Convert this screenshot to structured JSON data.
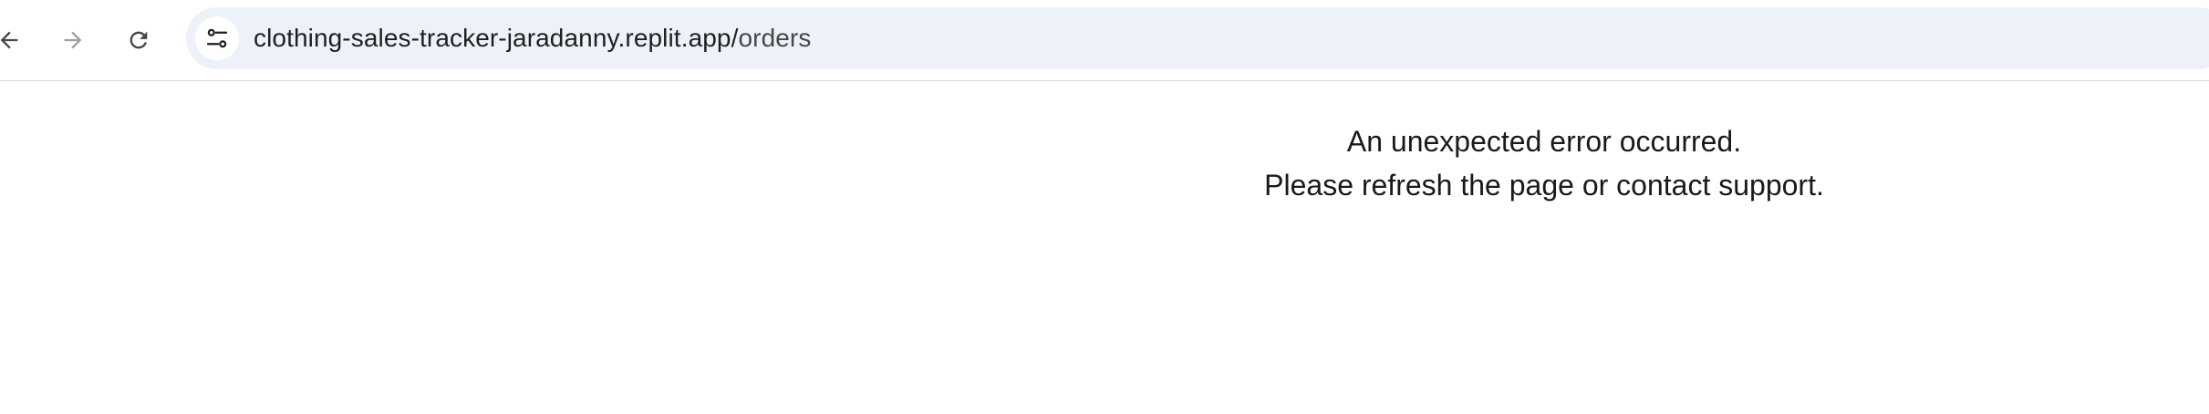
{
  "browser": {
    "url_host": "clothing-sales-tracker-jaradanny.replit.app/",
    "url_path": "orders",
    "icons": {
      "back": "arrow-back-icon",
      "forward": "arrow-forward-icon",
      "reload": "reload-icon",
      "site_info": "tune-icon"
    }
  },
  "page": {
    "error_line1": "An unexpected error occurred.",
    "error_line2": "Please refresh the page or contact support."
  },
  "colors": {
    "omnibox_bg": "#edf2fa",
    "text": "#1f1f1f",
    "disabled_icon": "#9aa0a6"
  }
}
